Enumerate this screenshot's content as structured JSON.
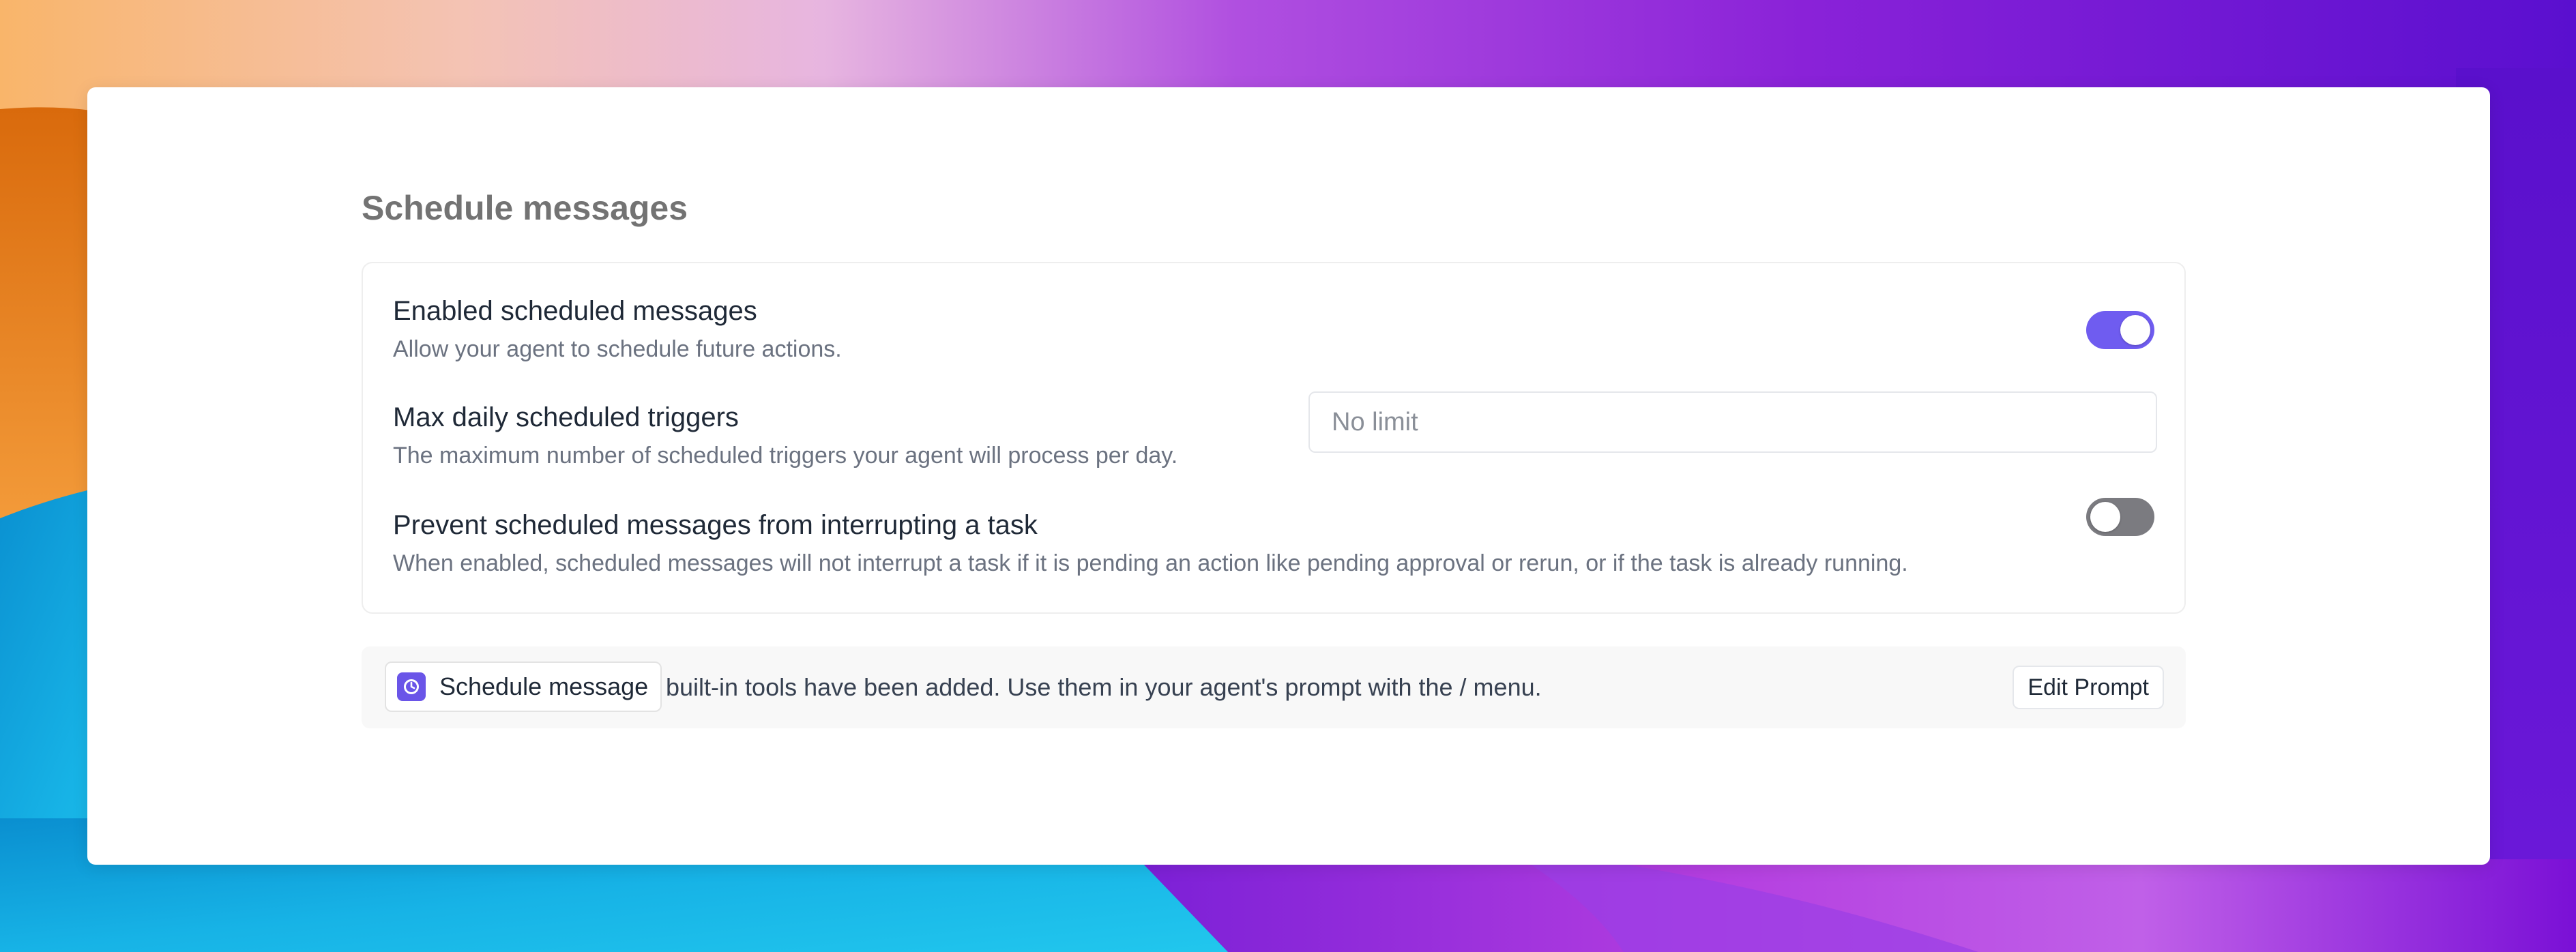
{
  "section": {
    "title": "Schedule messages"
  },
  "settings": {
    "enable_scheduled": {
      "label": "Enabled scheduled messages",
      "description": "Allow your agent to schedule future actions.",
      "enabled": true
    },
    "max_daily_triggers": {
      "label": "Max daily scheduled triggers",
      "description": "The maximum number of scheduled triggers your agent will process per day.",
      "value": "",
      "placeholder": "No limit"
    },
    "prevent_interrupt": {
      "label": "Prevent scheduled messages from interrupting a task",
      "description": "When enabled, scheduled messages will not interrupt a task if it is pending an action like pending approval or rerun, or if the task is already running.",
      "enabled": false
    }
  },
  "tools_bar": {
    "tool_chip_label": "Schedule message",
    "tool_chip_icon": "clock-icon",
    "message": "built-in tools have been added. Use them in your agent's prompt with the / menu.",
    "edit_prompt_label": "Edit Prompt"
  },
  "colors": {
    "accent": "#6f5cf0",
    "toggle_off": "#7b7b80"
  }
}
